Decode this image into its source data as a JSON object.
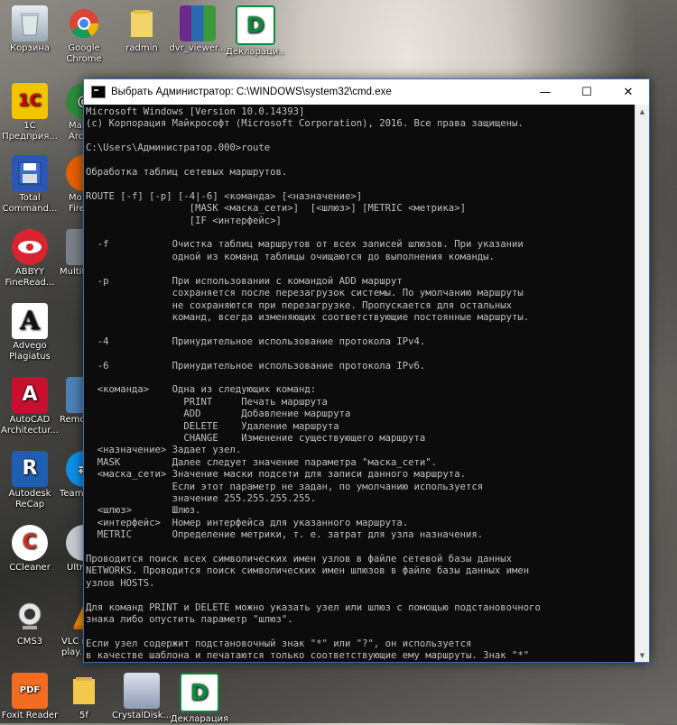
{
  "desktop": {
    "icons": [
      {
        "label": "Корзина"
      },
      {
        "label": "Google\nChrome"
      },
      {
        "label": "radmin"
      },
      {
        "label": "dvr_viewer..."
      },
      {
        "label": "Деклараци..."
      },
      {
        "label": "1С\nПредприя..."
      },
      {
        "label": "Mai\nArc..."
      },
      {
        "label": "Total\nCommand..."
      },
      {
        "label": "Mo\nFire..."
      },
      {
        "label": "ABBYY\nFineRead..."
      },
      {
        "label": "MultiB..."
      },
      {
        "label": "Advego\nPlagiatus"
      },
      {
        "label": "AutoCAD\nArchitectur..."
      },
      {
        "label": "Remot..."
      },
      {
        "label": "Autodesk\nReCap"
      },
      {
        "label": "TeamV..."
      },
      {
        "label": "CCleaner"
      },
      {
        "label": "Ultr..."
      },
      {
        "label": "CMS3"
      },
      {
        "label": "VLC m\nplay..."
      },
      {
        "label": "Foxit Reader"
      },
      {
        "label": "5f"
      },
      {
        "label": "CrystalDisk..."
      },
      {
        "label": "Декларация"
      }
    ]
  },
  "window": {
    "title": "Выбрать Администратор: C:\\WINDOWS\\system32\\cmd.exe",
    "minimize": "—",
    "maximize": "☐",
    "close": "✕"
  },
  "console": {
    "text": "Microsoft Windows [Version 10.0.14393]\n(c) Корпорация Майкрософт (Microsoft Corporation), 2016. Все права защищены.\n\nC:\\Users\\Администратор.000>route\n\nОбработка таблиц сетевых маршрутов.\n\nROUTE [-f] [-p] [-4|-6] <команда> [<назначение>]\n                  [MASK <маска_сети>]  [<шлюз>] [METRIC <метрика>]\n                  [IF <интерфейс>]\n\n  -f           Очистка таблиц маршрутов от всех записей шлюзов. При указании\n               одной из команд таблицы очищаются до выполнения команды.\n\n  -p           При использовании с командой ADD маршрут\n               сохраняется после перезагрузок системы. По умолчанию маршруты\n               не сохраняются при перезагрузке. Пропускается для остальных\n               команд, всегда изменяющих соответствующие постоянные маршруты.\n\n  -4           Принудительное использование протокола IPv4.\n\n  -6           Принудительное использование протокола IPv6.\n\n  <команда>    Одна из следующих команд:\n                 PRINT     Печать маршрута\n                 ADD       Добавление маршрута\n                 DELETE    Удаление маршрута\n                 CHANGE    Изменение существующего маршрута\n  <назначение> Задает узел.\n  MASK         Далее следует значение параметра \"маска_сети\".\n  <маска_сети> Значение маски подсети для записи данного маршрута.\n               Если этот параметр не задан, по умолчанию используется\n               значение 255.255.255.255.\n  <шлюз>       Шлюз.\n  <интерфейс>  Номер интерфейса для указанного маршрута.\n  METRIC       Определение метрики, т. е. затрат для узла назначения.\n\nПроводится поиск всех символических имен узлов в файле сетевой базы данных\nNETWORKS. Проводится поиск символических имен шлюзов в файле базы данных имен\nузлов HOSTS.\n\nДля команд PRINT и DELETE можно указать узел или шлюз с помощью подстановочного\nзнака либо опустить параметр \"шлюз\".\n\nЕсли узел содержит подстановочный знак \"*\" или \"?\", он используется\nв качестве шаблона и печатаются только соответствующие ему маршруты. Знак \"*\""
  },
  "colors": {
    "console_bg": "#0c0c0c",
    "console_fg": "#c0c0c0",
    "titlebar_bg": "#ffffff"
  }
}
